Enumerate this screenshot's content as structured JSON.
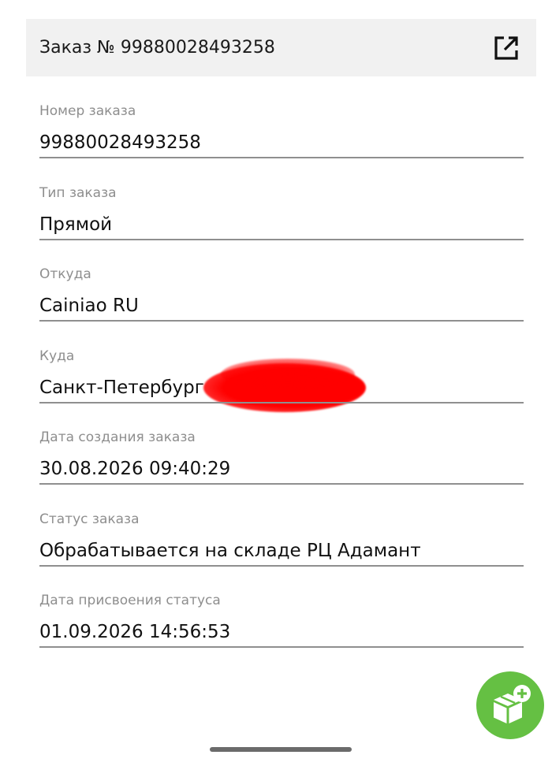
{
  "header": {
    "title": "Заказ № 99880028493258",
    "action_icon": "open-in-new-icon"
  },
  "fields": [
    {
      "label": "Номер заказа",
      "value": "99880028493258"
    },
    {
      "label": "Тип заказа",
      "value": "Прямой"
    },
    {
      "label": "Откуда",
      "value": "Cainiao RU"
    },
    {
      "label": "Куда",
      "value": "Санкт-Петербург"
    },
    {
      "label": "Дата создания заказа",
      "value": "30.08.2026 09:40:29"
    },
    {
      "label": "Статус заказа",
      "value": "Обрабатывается на складе РЦ Адамант"
    },
    {
      "label": "Дата присвоения статуса",
      "value": "01.09.2026 14:56:53"
    }
  ],
  "fab": {
    "icon": "add-package-icon",
    "color": "#65c043"
  },
  "colors": {
    "header_bg": "#f1f1f1",
    "label": "#8e8e8e",
    "divider": "#8f8f8f",
    "redaction": "#ff0000"
  }
}
